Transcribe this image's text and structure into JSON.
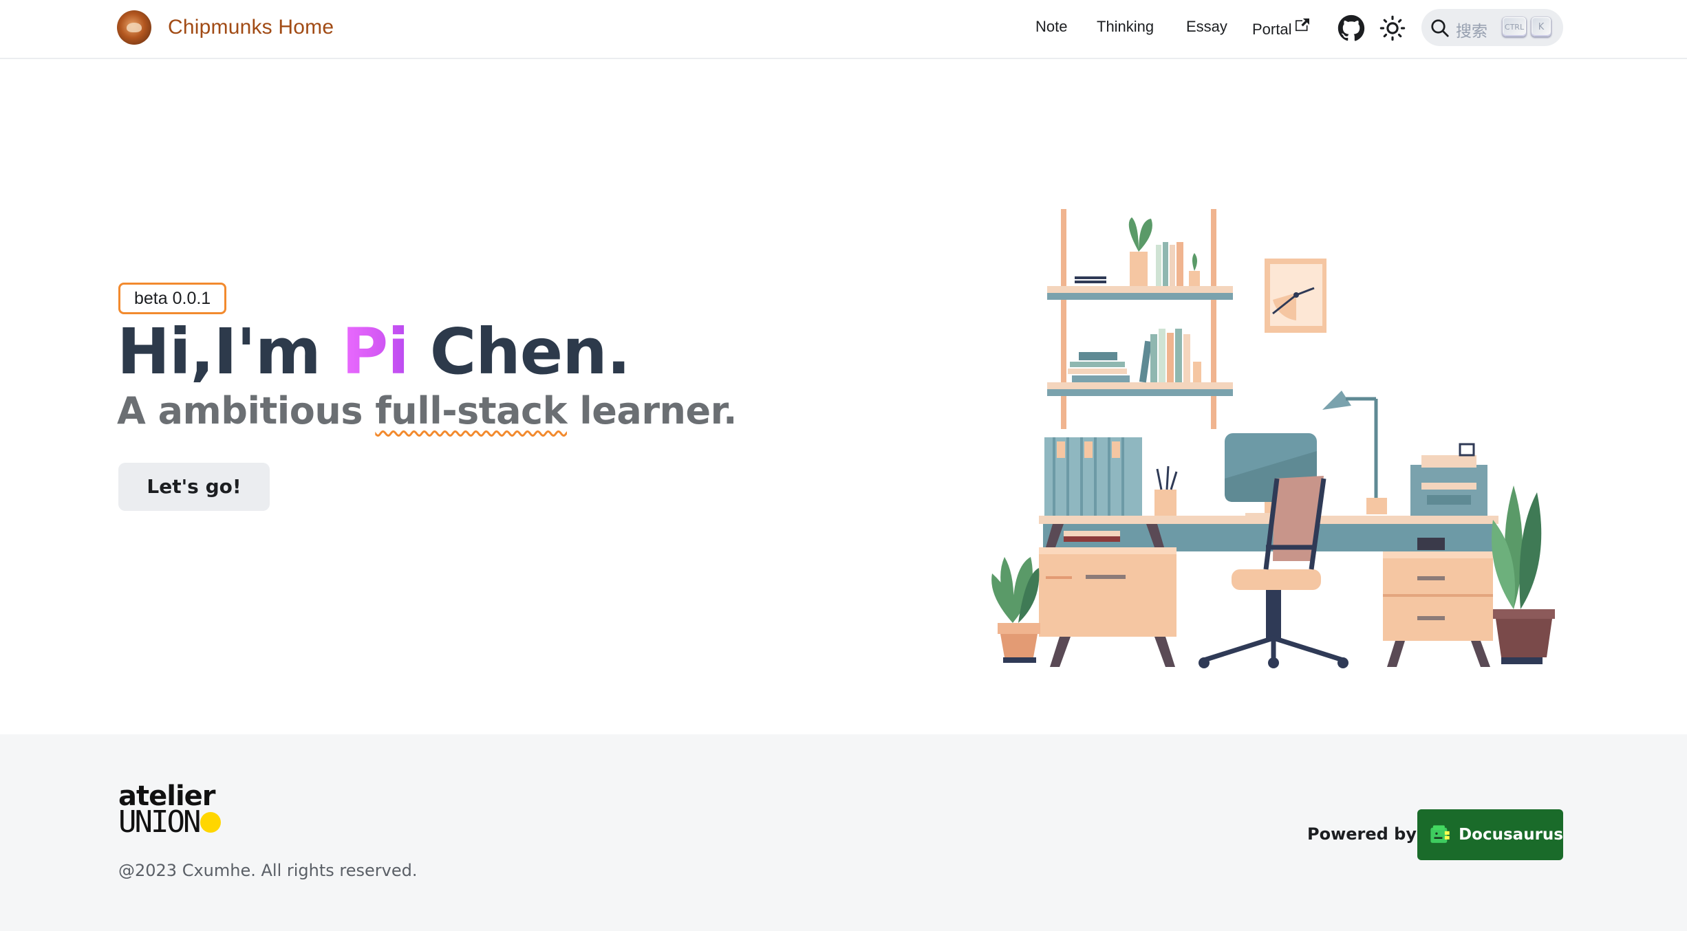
{
  "navbar": {
    "brand_title": "Chipmunks Home",
    "links": {
      "note": "Note",
      "thinking": "Thinking",
      "essay": "Essay",
      "portal": "Portal"
    },
    "search": {
      "placeholder": "搜索",
      "key_ctrl": "CTRL",
      "key_k": "K"
    },
    "icons": {
      "github": "github-icon",
      "theme_toggle": "sun-icon",
      "external_link": "external-link-icon",
      "search": "search-icon"
    }
  },
  "hero": {
    "badge": "beta 0.0.1",
    "headline_prefix": "Hi,I'm",
    "headline_highlight": "Pi",
    "headline_suffix": "Chen.",
    "subline_prefix": "A ambitious",
    "subline_highlight": "full-stack",
    "subline_suffix": "learner.",
    "cta_label": "Let's go!",
    "illustration": "home-office-illustration"
  },
  "footer": {
    "logo_top": "atelier",
    "logo_bottom": "UNION",
    "copyright": "@2023 Cxumhe. All rights reserved.",
    "powered_by": "Powered by",
    "docusaurus_label": "Docusaurus"
  },
  "colors": {
    "brand": "#a14b15",
    "badge_border": "#f28a2e",
    "headline": "#2d3a4b",
    "highlight_gradient": [
      "#ea6bff",
      "#b94bf0"
    ],
    "subline": "#6b6f73",
    "docusaurus_bg": "#1a6b2a",
    "union_dot": "#ffd600"
  }
}
